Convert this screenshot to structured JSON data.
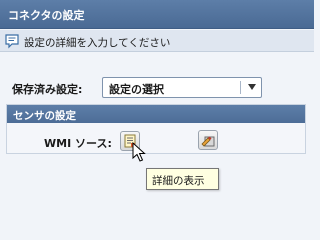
{
  "window": {
    "title": "コネクタの設定"
  },
  "info_bar": {
    "icon": "info-note-icon",
    "text": "設定の詳細を入力してください"
  },
  "saved_settings": {
    "label": "保存済み設定:",
    "selected": "設定の選択"
  },
  "sensor_group": {
    "title": "センサの設定",
    "wmi_label": "WMI ソース:",
    "details_button_icon": "details-icon",
    "edit_button_icon": "edit-icon"
  },
  "tooltip": {
    "text": "詳細の表示"
  },
  "colors": {
    "titlebar": "#5d7ea8",
    "background": "#f1f4f9",
    "tooltip_bg": "#ffffe1"
  }
}
